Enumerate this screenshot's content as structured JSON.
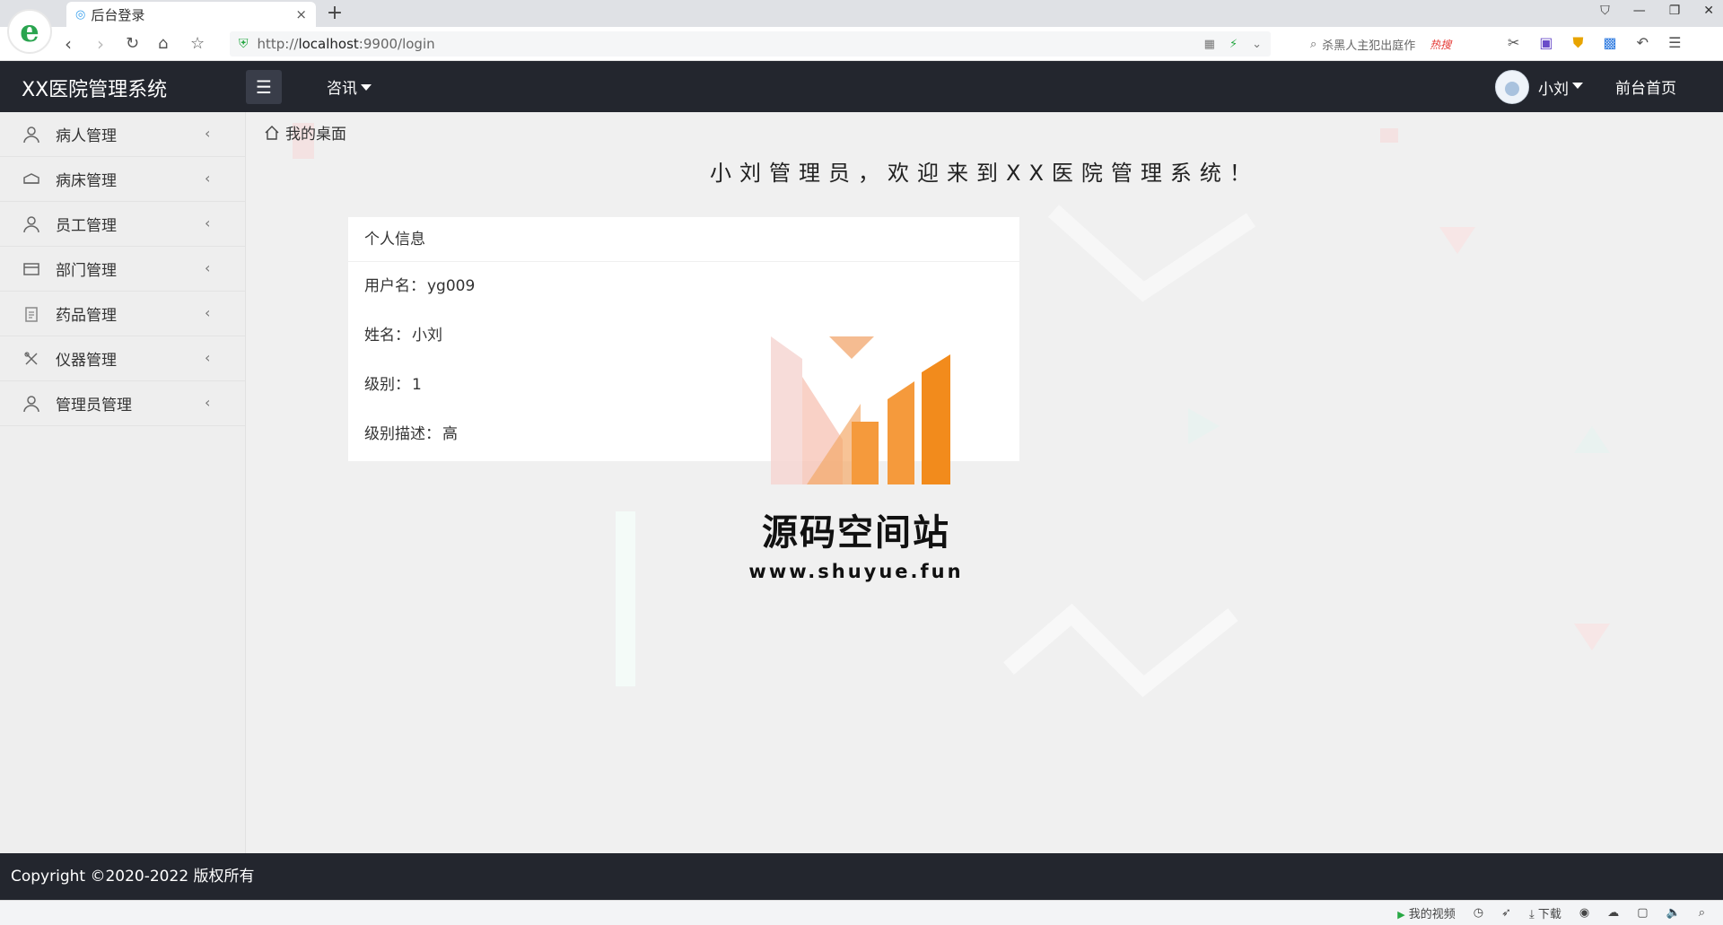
{
  "browser": {
    "tab_title": "后台登录",
    "tab_close": "×",
    "new_tab": "+",
    "url_prefix": "http://",
    "url_host": "localhost",
    "url_rest": ":9900/login",
    "search_placeholder": "杀黑人主犯出庭作",
    "search_hot": "热搜",
    "status_video": "我的视频",
    "status_download": "下载"
  },
  "header": {
    "title": "XX医院管理系统",
    "nav_news": "咨讯",
    "user_name": "小刘",
    "front_home": "前台首页"
  },
  "sidebar": {
    "items": [
      {
        "label": "病人管理",
        "icon": "user-icon"
      },
      {
        "label": "病床管理",
        "icon": "bed-icon"
      },
      {
        "label": "员工管理",
        "icon": "staff-icon"
      },
      {
        "label": "部门管理",
        "icon": "department-icon"
      },
      {
        "label": "药品管理",
        "icon": "medicine-icon"
      },
      {
        "label": "仪器管理",
        "icon": "instrument-icon"
      },
      {
        "label": "管理员管理",
        "icon": "admin-icon"
      }
    ]
  },
  "main": {
    "breadcrumb": "我的桌面",
    "welcome": "小刘管理员，欢迎来到XX医院管理系统！",
    "card": {
      "title": "个人信息",
      "rows": [
        {
          "label": "用户名：",
          "value": "yg009"
        },
        {
          "label": "姓名：",
          "value": "小刘"
        },
        {
          "label": "级别：",
          "value": "1"
        },
        {
          "label": "级别描述：",
          "value": "高"
        }
      ]
    },
    "watermark": {
      "name": "源码空间站",
      "url": "www.shuyue.fun"
    }
  },
  "footer": {
    "copyright": "Copyright ©2020-2022 版权所有"
  },
  "colors": {
    "header_bg": "#23262e",
    "sidebar_bg": "#eeeeee",
    "accent_orange": "#f28b1c"
  }
}
